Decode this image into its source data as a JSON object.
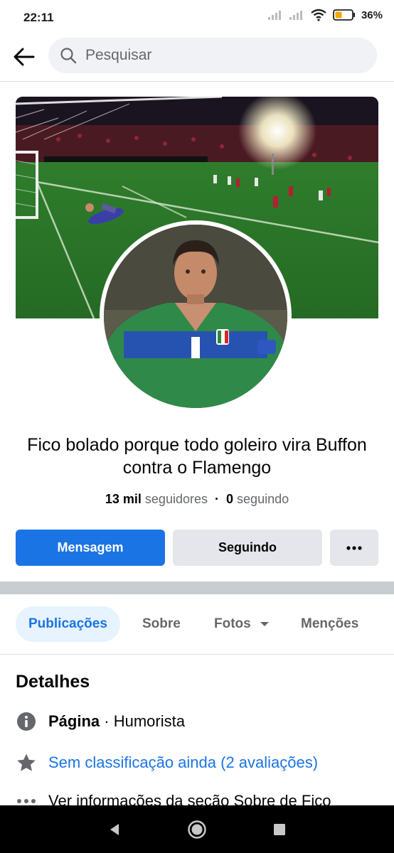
{
  "status_bar": {
    "time": "22:11",
    "battery_percent": "36%"
  },
  "header": {
    "search_placeholder": "Pesquisar"
  },
  "profile": {
    "name": "Fico bolado porque todo goleiro vira Buffon contra o Flamengo",
    "followers_count": "13 mil",
    "followers_label": "seguidores",
    "separator": "·",
    "following_count": "0",
    "following_label": "seguindo"
  },
  "actions": {
    "message_label": "Mensagem",
    "following_label": "Seguindo",
    "more_label": "•••"
  },
  "tabs": [
    {
      "label": "Publicações",
      "active": true
    },
    {
      "label": "Sobre",
      "active": false
    },
    {
      "label": "Fotos",
      "active": false
    },
    {
      "label": "Menções",
      "active": false
    }
  ],
  "details": {
    "title": "Detalhes",
    "category_label": "Página",
    "category_sep": " · ",
    "category_value": "Humorista",
    "rating": "Sem classificação ainda (2 avaliações)",
    "about": "Ver informações da seção Sobre de Fico"
  },
  "colors": {
    "accent": "#1b74e4",
    "button_gray": "#e4e6eb",
    "tab_active_bg": "#e7f3ff"
  },
  "icons": [
    "back-arrow-icon",
    "search-icon",
    "info-icon",
    "star-icon",
    "ellipsis-icon",
    "chevron-down-icon"
  ]
}
